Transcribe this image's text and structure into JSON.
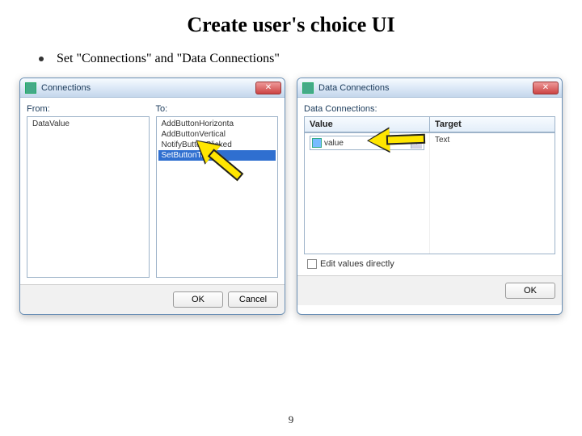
{
  "title": "Create user's choice UI",
  "bullet": "Set \"Connections\" and \"Data Connections\"",
  "page": "9",
  "dlg1": {
    "title": "Connections",
    "from_label": "From:",
    "to_label": "To:",
    "from_items": [
      "DataValue"
    ],
    "to_items": [
      "AddButtonHorizonta",
      "AddButtonVertical",
      "NotifyButtonClicked",
      "SetButtonText"
    ],
    "ok": "OK",
    "cancel": "Cancel"
  },
  "dlg2": {
    "title": "Data Connections",
    "header": "Data Connections:",
    "col_value": "Value",
    "col_target": "Target",
    "combo_value": "value",
    "target_text": "Text",
    "edit_label": "Edit values directly",
    "ok": "OK"
  }
}
